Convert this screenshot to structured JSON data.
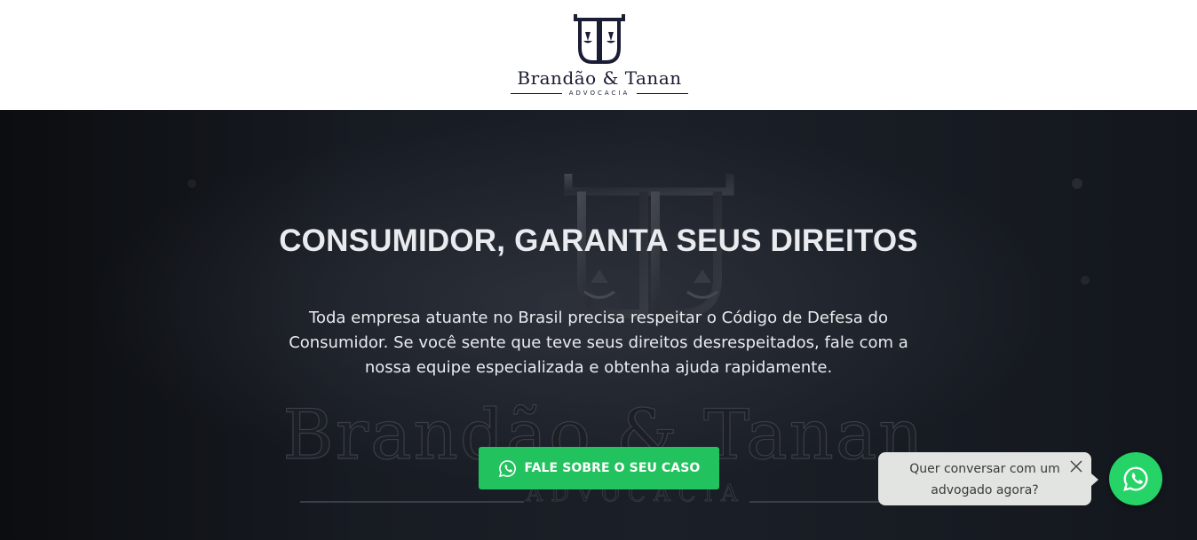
{
  "brand": {
    "name": "Brandão & Tanan",
    "subtitle": "ADVOCACIA",
    "background_wall_name": "Brandão & Tanan",
    "background_wall_subtitle": "ADVOCACIA"
  },
  "hero": {
    "title": "CONSUMIDOR, GARANTA SEUS DIREITOS",
    "text": "Toda empresa atuante no Brasil precisa respeitar o Código de Defesa do Consumidor. Se você sente que teve seus direitos desrespeitados, fale com a nossa equipe especializada e obtenha ajuda rapidamente.",
    "cta_label": "FALE SOBRE O SEU CASO",
    "cta_icon": "whatsapp-icon"
  },
  "chat_widget": {
    "message": "Quer conversar com um advogado agora?",
    "close_icon": "close-icon",
    "button_icon": "whatsapp-icon"
  },
  "colors": {
    "brand_navy": "#1a1d33",
    "cta_green": "#22c35e",
    "whatsapp_green": "#25d366",
    "hero_bg": "#171b22",
    "bubble_bg": "#e2e4e2"
  }
}
